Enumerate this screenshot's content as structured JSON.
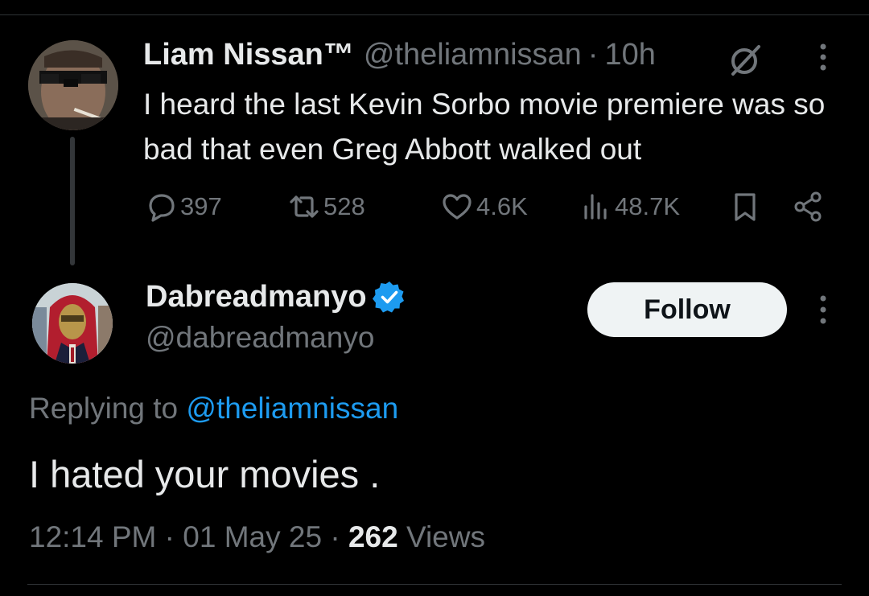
{
  "parent_tweet": {
    "display_name": "Liam Nissan™",
    "handle": "@theliamnissan",
    "separator": "·",
    "time": "10h",
    "text": "I heard the last Kevin Sorbo movie premiere was so bad that even Greg Abbott walked out",
    "stats": {
      "replies": "397",
      "reposts": "528",
      "likes": "4.6K",
      "views": "48.7K"
    }
  },
  "reply_tweet": {
    "display_name": "Dabreadmanyo",
    "handle": "@dabreadmanyo",
    "verified": true,
    "follow_label": "Follow",
    "replying_prefix": "Replying to",
    "replying_handle": "@theliamnissan",
    "text": "I hated your movies .",
    "time": "12:14 PM",
    "separator": "·",
    "date": "01 May 25",
    "views_count": "262",
    "views_label": "Views"
  },
  "colors": {
    "background": "#000000",
    "primary_text": "#e7e9ea",
    "secondary_text": "#71767b",
    "accent_blue": "#1d9bf0",
    "follow_button_bg": "#eff3f4"
  },
  "icons": {
    "reply": "speech-bubble-icon",
    "repost": "repost-arrows-icon",
    "like": "heart-icon",
    "views": "bar-chart-icon",
    "bookmark": "bookmark-icon",
    "share": "share-icon",
    "grok": "grok-icon",
    "more": "more-vertical-icon",
    "verified": "verified-badge-icon"
  }
}
